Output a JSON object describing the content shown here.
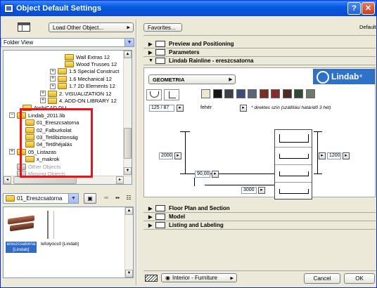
{
  "window": {
    "title": "Object Default Settings",
    "help": "?",
    "close": "✕"
  },
  "left": {
    "load_other": "Load Other Object...",
    "folder_view": "Folder View",
    "tree": [
      {
        "label": "Wall Extras 12",
        "indent": 90,
        "exp": "",
        "grey": false
      },
      {
        "label": "Wood Trusses 12",
        "indent": 90,
        "exp": "",
        "grey": false
      },
      {
        "label": "1.5 Special Construct",
        "indent": 80,
        "exp": "+",
        "grey": false
      },
      {
        "label": "1.6 Mechanical 12",
        "indent": 80,
        "exp": "+",
        "grey": false
      },
      {
        "label": "1.7 2D Elements 12",
        "indent": 80,
        "exp": "+",
        "grey": false
      },
      {
        "label": "2. VISUALIZATION 12",
        "indent": 66,
        "exp": "+",
        "grey": false
      },
      {
        "label": "4. ADD-ON LIBRARY 12",
        "indent": 66,
        "exp": "+",
        "grey": false
      },
      {
        "label": "ArchiCAD DLL",
        "indent": 30,
        "exp": "",
        "grey": false
      },
      {
        "label": "Lindab_2011.lib",
        "indent": 22,
        "exp": "−",
        "grey": false
      },
      {
        "label": "01_Ereszcsatorna",
        "indent": 34,
        "exp": "",
        "grey": false
      },
      {
        "label": "02_Falburkolat",
        "indent": 34,
        "exp": "",
        "grey": false
      },
      {
        "label": "03_Tetőbiztonság",
        "indent": 34,
        "exp": "",
        "grey": false
      },
      {
        "label": "04_Tetőhéjalás",
        "indent": 34,
        "exp": "",
        "grey": false
      },
      {
        "label": "05_Listazas",
        "indent": 22,
        "exp": "+",
        "grey": false
      },
      {
        "label": "x_makrok",
        "indent": 34,
        "exp": "",
        "grey": false
      },
      {
        "label": "Other Objects",
        "indent": 22,
        "exp": "",
        "grey": true
      },
      {
        "label": "Missing Objects",
        "indent": 22,
        "exp": "",
        "grey": true
      }
    ],
    "folder_select": "01_Ereszcsatorna",
    "thumb1": "ereszcsatorna [Lindab]",
    "thumb2": "lefolyócső [Lindab]"
  },
  "right": {
    "favorites": "Favorites...",
    "default": "Default",
    "sections_top": [
      "Preview and Positioning",
      "Parameters",
      "Lindab Rainline - ereszcsatorna"
    ],
    "geometria": "GEOMETRIA",
    "logo": "Lindab",
    "logo_mark": "®",
    "scale": "125 / 87",
    "color_name": "fehér",
    "note": "* direktes szín (szállítási határidő 3 hét)",
    "dim_2000": "2000",
    "dim_90": "90,00",
    "dim_3000": "3000",
    "dim_1200": "1200",
    "sections_bottom": [
      "Floor Plan and Section",
      "Model",
      "Listing and Labeling"
    ],
    "layer": "Interior - Furniture",
    "cancel": "Cancel",
    "ok": "OK"
  },
  "colors": {
    "swatches": [
      "#ece6d2",
      "#151515",
      "#3c4148",
      "#3e4c78",
      "#5b6776",
      "#7a2e22",
      "#862c2e",
      "#4b2a22",
      "#2e4a36",
      "#6d7a6a"
    ]
  }
}
